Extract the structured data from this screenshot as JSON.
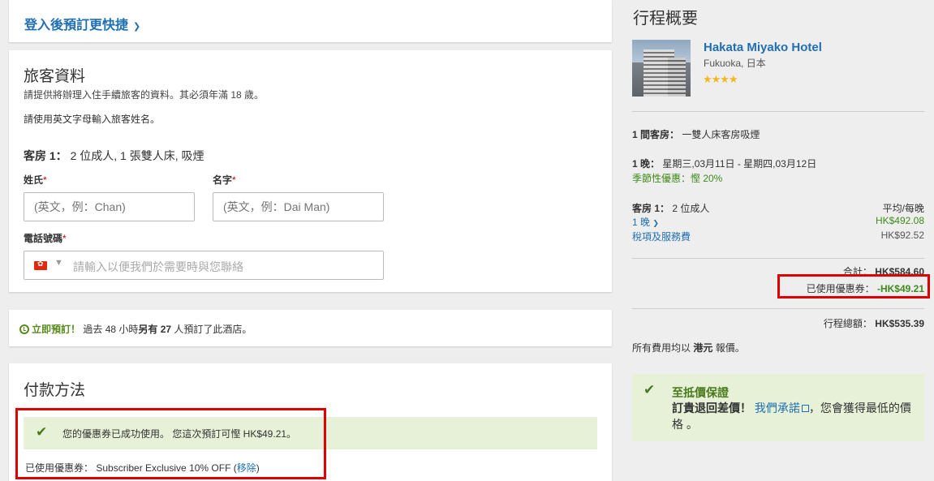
{
  "login": {
    "label": "登入後預訂更快捷",
    "chevron": "»"
  },
  "traveler": {
    "title": "旅客資料",
    "note": "請提供將辦理入住手續旅客的資料。其必須年滿 18 歲。",
    "name_note": "請使用英文字母輸入旅客姓名。",
    "room_label": "客房 1：",
    "room_desc": "2 位成人, 1 張雙人床, 吸煙",
    "lastname_label": "姓氏",
    "lastname_placeholder": "(英文，例：Chan)",
    "firstname_label": "名字",
    "firstname_placeholder": "(英文，例：Dai Man)",
    "phone_label": "電話號碼",
    "phone_placeholder": "請輸入以便我們於需要時與您聯絡",
    "required_mark": "*",
    "phone_flag_icon": "hong-kong-flag-icon"
  },
  "notice": {
    "now": "立即預訂！",
    "text_1": "過去 48 小時",
    "text_2": "另有 27",
    "text_3": "人預訂了此酒店。"
  },
  "payment": {
    "title": "付款方法",
    "success_msg": "您的優惠券已成功使用。 您這次預訂可慳 HK$49.21。",
    "coupon_used_label": "已使用優惠券：",
    "coupon_name": "Subscriber Exclusive 10% OFF",
    "remove_label": "移除"
  },
  "summary": {
    "title": "行程概要",
    "hotel_name": "Hakata Miyako Hotel",
    "hotel_location": "Fukuoka, 日本",
    "star_rating": 3.5,
    "room_count_label": "1 間客房：",
    "room_type": "一雙人床客房吸煙",
    "nights_label": "1 晚：",
    "dates": "星期三,03月11日 - 星期四,03月12日",
    "seasonal": "季節性優惠：慳 20%",
    "room1_label": "客房 1：",
    "room1_guests": "2 位成人",
    "avg_label": "平均/每晚",
    "nights_link": "1 晚",
    "nightly_price": "HK$492.08",
    "tax_label": "稅項及服務費",
    "tax_price": "HK$92.52",
    "subtotal_label": "合計：",
    "subtotal": "HK$584.60",
    "coupon_label": "已使用優惠券：",
    "coupon_amount": "-HK$49.21",
    "total_label": "行程總額：",
    "total": "HK$535.39",
    "currency_note_1": "所有費用均以",
    "currency_note_bold": "港元",
    "currency_note_2": "報價。"
  },
  "guarantee": {
    "title": "至抵價保證",
    "bold": "訂貴退回差價！",
    "link": "我們承諾",
    "rest": "，您會獲得最低的價格 。"
  },
  "colors": {
    "link_blue": "#1f6fb2",
    "green": "#3f8a1c",
    "highlight_red": "#e00000",
    "success_bg": "#e6f1d8"
  }
}
